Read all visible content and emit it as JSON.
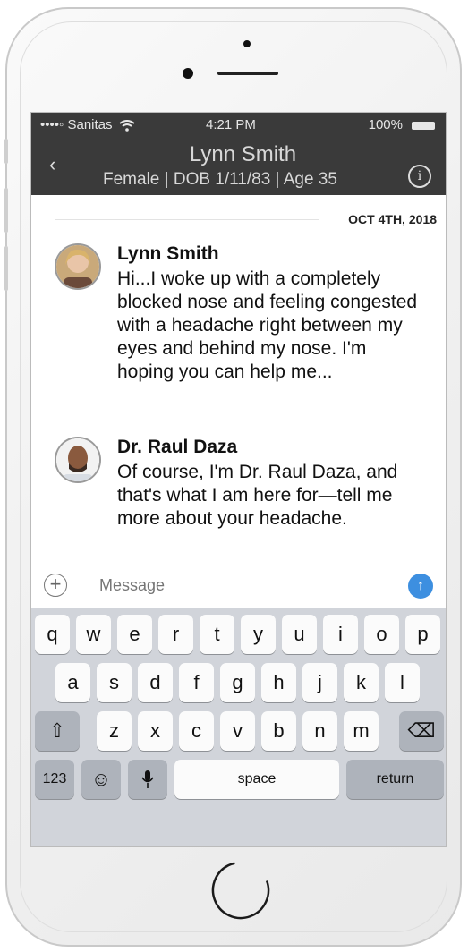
{
  "status_bar": {
    "carrier": "••••◦ Sanitas",
    "time": "4:21 PM",
    "battery": "100%"
  },
  "header": {
    "back_icon": "‹",
    "patient_name": "Lynn Smith",
    "patient_details": "Female |  DOB 1/11/83  |  Age 35",
    "info_icon": "i"
  },
  "conversation": {
    "date": "OCT 4TH, 2018",
    "messages": [
      {
        "sender": "Lynn Smith",
        "text": "Hi...I woke up with a completely blocked nose and feeling congested with a headache right between my eyes and behind my nose. I'm hoping you can help me..."
      },
      {
        "sender": "Dr. Raul Daza",
        "text": "Of course, I'm Dr. Raul Daza, and that's what I am here for—tell me more about your headache."
      }
    ]
  },
  "composer": {
    "plus_icon": "+",
    "placeholder": "Message",
    "send_icon": "↑"
  },
  "keyboard": {
    "row1": [
      "q",
      "w",
      "e",
      "r",
      "t",
      "y",
      "u",
      "i",
      "o",
      "p"
    ],
    "row2": [
      "a",
      "s",
      "d",
      "f",
      "g",
      "h",
      "j",
      "k",
      "l"
    ],
    "row3": [
      "z",
      "x",
      "c",
      "v",
      "b",
      "n",
      "m"
    ],
    "shift_icon": "⇧",
    "delete_icon": "⌫",
    "numbers": "123",
    "emoji_icon": "☺",
    "mic_icon": "🎤",
    "space": "space",
    "return": "return"
  },
  "colors": {
    "header_bg": "#3a3a3a",
    "send_button": "#3d8fe0",
    "keyboard_bg": "#d1d4da"
  }
}
